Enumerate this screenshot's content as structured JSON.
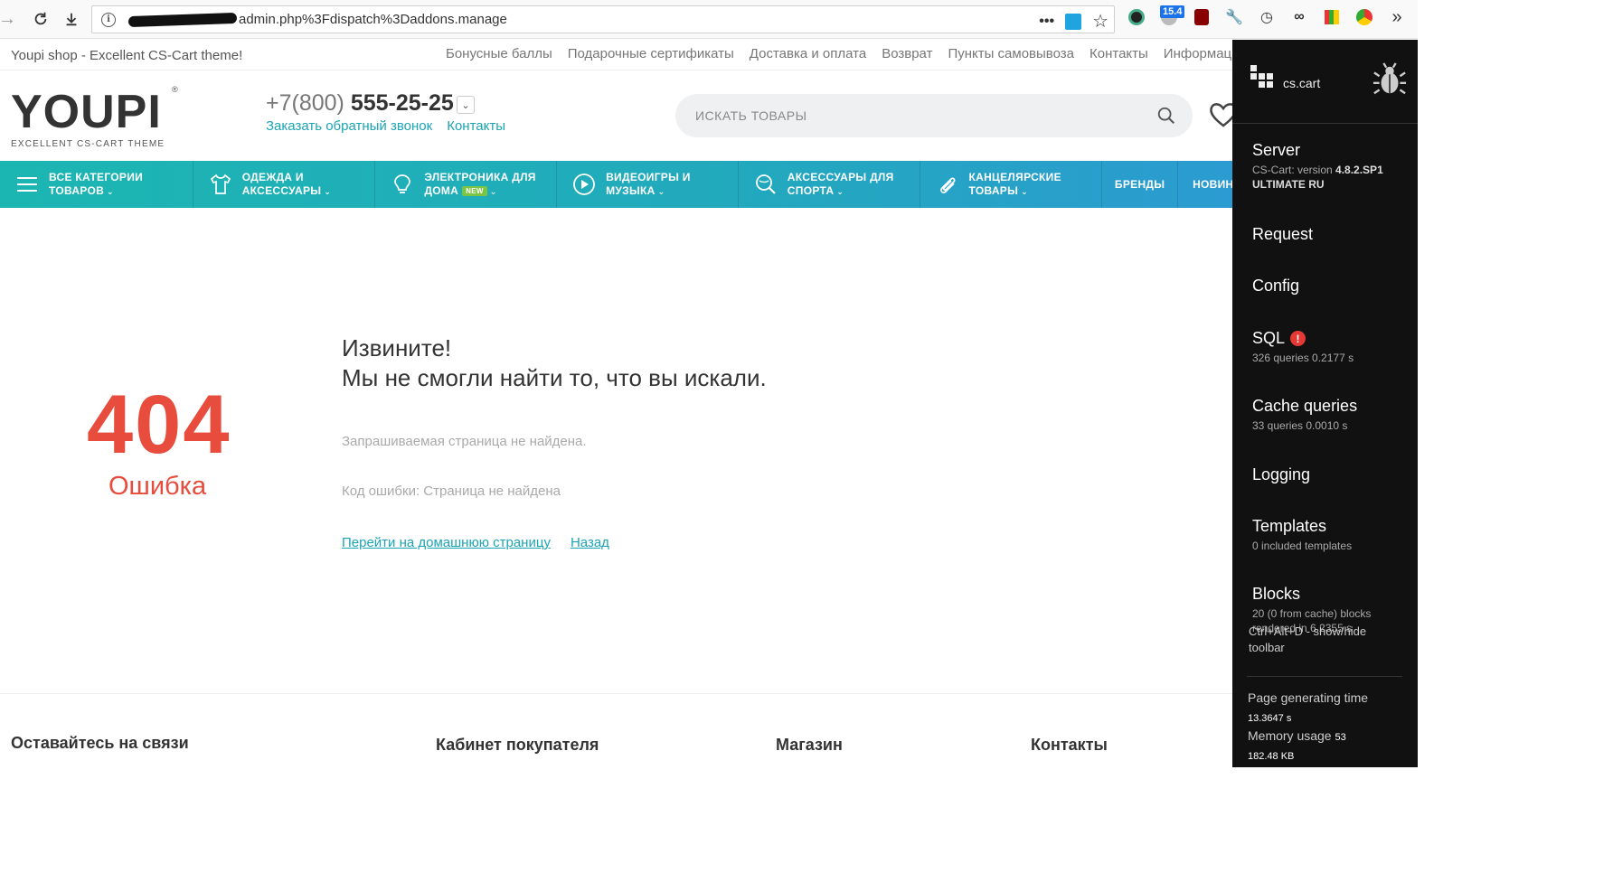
{
  "browser": {
    "url_text": "admin.php%3Fdispatch%3Daddons.manage",
    "ext_badge": "15.4"
  },
  "topbar": {
    "shop_title": "Youpi shop - Excellent CS-Cart theme!",
    "links": [
      "Бонусные баллы",
      "Подарочные сертификаты",
      "Доставка и оплата",
      "Возврат",
      "Пункты самовывоза",
      "Контакты",
      "Информаци"
    ]
  },
  "header": {
    "logo_text": "YOUPI",
    "logo_reg": "®",
    "logo_tagline": "EXCELLENT CS-CART THEME",
    "phone_code": "+7(800)",
    "phone_number": "555-25-25",
    "callback_link": "Заказать обратный звонок",
    "contacts_link": "Контакты",
    "search_placeholder": "ИСКАТЬ ТОВАРЫ"
  },
  "categories": [
    {
      "line1": "ВСЕ КАТЕГОРИИ",
      "line2": "ТОВАРОВ",
      "icon": "menu-icon"
    },
    {
      "line1": "ОДЕЖДА И",
      "line2": "АКСЕССУАРЫ",
      "icon": "tshirt-icon"
    },
    {
      "line1": "ЭЛЕКТРОНИКА ДЛЯ",
      "line2": "ДОМА",
      "badge": "NEW",
      "icon": "lightbulb-icon"
    },
    {
      "line1": "ВИДЕОИГРЫ И",
      "line2": "МУЗЫКА",
      "icon": "play-icon"
    },
    {
      "line1": "АКСЕССУАРЫ ДЛЯ",
      "line2": "СПОРТА",
      "icon": "tennis-icon"
    },
    {
      "line1": "КАНЦЕЛЯРСКИЕ",
      "line2": "ТОВАРЫ",
      "icon": "paperclip-icon"
    },
    {
      "label": "БРЕНДЫ"
    },
    {
      "label": "НОВИН"
    }
  ],
  "error": {
    "code": "404",
    "word": "Ошибка",
    "title_line1": "Извините!",
    "title_line2": "Мы не смогли найти то, что вы искали.",
    "description": "Запрашиваемая страница не найдена.",
    "code_text": "Код ошибки: Страница не найдена",
    "home_link": "Перейти на домашнюю страницу",
    "back_link": "Назад"
  },
  "footer": {
    "headings": [
      "Оставайтесь на связи",
      "Кабинет покупателя",
      "Магазин",
      "Контакты"
    ]
  },
  "debug": {
    "logo_text": "cs.cart",
    "server": {
      "title": "Server",
      "line1_prefix": "CS-Cart: version ",
      "version": "4.8.2.SP1",
      "edition": "ULTIMATE RU"
    },
    "request": {
      "title": "Request"
    },
    "config": {
      "title": "Config"
    },
    "sql": {
      "title": "SQL",
      "alert": "!",
      "sub": "326 queries 0.2177 s"
    },
    "cache": {
      "title": "Cache queries",
      "sub": "33 queries 0.0010 s"
    },
    "logging": {
      "title": "Logging"
    },
    "templates": {
      "title": "Templates",
      "sub": "0 included templates"
    },
    "blocks": {
      "title": "Blocks",
      "sub": "20 (0 from cache) blocks rendered in 6.2355 s"
    },
    "hint": "Ctrl+Alt+D - show/hide toolbar",
    "page_time_label": "Page generating time",
    "page_time_value": "13.3647 s",
    "memory_label": "Memory usage",
    "memory_value_a": "53",
    "memory_value_b": "182.48 KB"
  }
}
